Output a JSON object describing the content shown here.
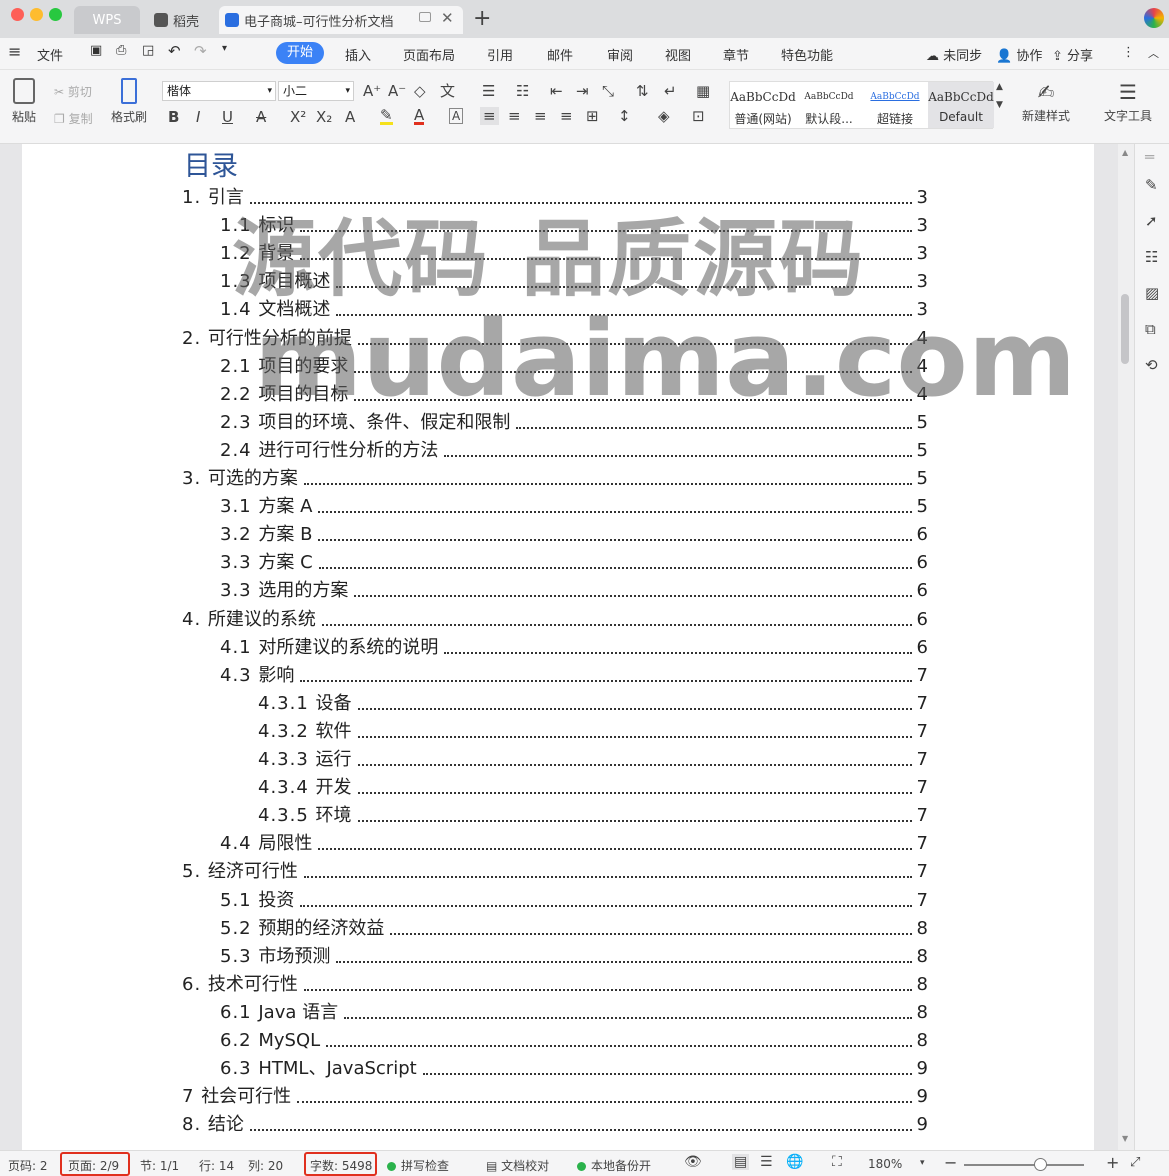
{
  "titlebar": {
    "tabs": [
      {
        "label": "WPS"
      },
      {
        "label": "稻壳"
      },
      {
        "label": "电子商城–可行性分析文档"
      }
    ],
    "new_tab_symbol": "+"
  },
  "menubar": {
    "file_label": "文件",
    "items": [
      "开始",
      "插入",
      "页面布局",
      "引用",
      "邮件",
      "审阅",
      "视图",
      "章节",
      "特色功能"
    ],
    "right": {
      "sync": "未同步",
      "collab": "协作",
      "share": "分享"
    }
  },
  "toolbar": {
    "paste": "粘贴",
    "cut": "剪切",
    "copy": "复制",
    "format_painter": "格式刷",
    "font_name": "楷体",
    "font_size": "小二",
    "styles": [
      {
        "sample": "AaBbCcDd",
        "name": "普通(网站)"
      },
      {
        "sample": "AaBbCcDd",
        "name": "默认段..."
      },
      {
        "sample": "AaBbCcDd",
        "name": "超链接"
      },
      {
        "sample": "AaBbCcDd",
        "name": "Default"
      }
    ],
    "new_style": "新建样式",
    "text_tool": "文字工具"
  },
  "document": {
    "toc_title": "目录",
    "entries": [
      {
        "num": "1. ",
        "text": "引言",
        "page": "3",
        "level": 1
      },
      {
        "num": "1.1 ",
        "text": "标识",
        "page": "3",
        "level": 2
      },
      {
        "num": "1.2 ",
        "text": "背景",
        "page": "3",
        "level": 2
      },
      {
        "num": "1.3 ",
        "text": "项目概述",
        "page": "3",
        "level": 2
      },
      {
        "num": "1.4 ",
        "text": "文档概述",
        "page": "3",
        "level": 2
      },
      {
        "num": "2. ",
        "text": "可行性分析的前提",
        "page": "4",
        "level": 1
      },
      {
        "num": "2.1 ",
        "text": "项目的要求",
        "page": "4",
        "level": 2
      },
      {
        "num": "2.2 ",
        "text": "项目的目标",
        "page": "4",
        "level": 2
      },
      {
        "num": "2.3 ",
        "text": "项目的环境、条件、假定和限制",
        "page": "5",
        "level": 2
      },
      {
        "num": "2.4 ",
        "text": "进行可行性分析的方法",
        "page": "5",
        "level": 2
      },
      {
        "num": "3. ",
        "text": "可选的方案",
        "page": "5",
        "level": 1
      },
      {
        "num": "3.1 ",
        "text": "方案 A",
        "page": "5",
        "level": 2
      },
      {
        "num": "3.2 ",
        "text": "方案 B",
        "page": "6",
        "level": 2
      },
      {
        "num": "3.3 ",
        "text": "方案 C",
        "page": "6",
        "level": 2
      },
      {
        "num": "3.3 ",
        "text": "选用的方案",
        "page": "6",
        "level": 2
      },
      {
        "num": "4. ",
        "text": "所建议的系统",
        "page": "6",
        "level": 1
      },
      {
        "num": "4.1 ",
        "text": "对所建议的系统的说明",
        "page": "6",
        "level": 2
      },
      {
        "num": "4.3 ",
        "text": "影响",
        "page": "7",
        "level": 2
      },
      {
        "num": "4.3.1 ",
        "text": "设备",
        "page": "7",
        "level": 3
      },
      {
        "num": "4.3.2 ",
        "text": "软件",
        "page": "7",
        "level": 3
      },
      {
        "num": "4.3.3 ",
        "text": "运行",
        "page": "7",
        "level": 3
      },
      {
        "num": "4.3.4 ",
        "text": "开发",
        "page": "7",
        "level": 3
      },
      {
        "num": "4.3.5 ",
        "text": "环境",
        "page": "7",
        "level": 3
      },
      {
        "num": "4.4 ",
        "text": "局限性",
        "page": "7",
        "level": 2
      },
      {
        "num": "5. ",
        "text": "经济可行性",
        "page": "7",
        "level": 1
      },
      {
        "num": "5.1 ",
        "text": "投资",
        "page": "7",
        "level": 2
      },
      {
        "num": "5.2 ",
        "text": "预期的经济效益",
        "page": "8",
        "level": 2
      },
      {
        "num": "5.3 ",
        "text": "市场预测",
        "page": "8",
        "level": 2
      },
      {
        "num": "6. ",
        "text": "技术可行性",
        "page": "8",
        "level": 1
      },
      {
        "num": "6.1 ",
        "text": "Java 语言",
        "page": "8",
        "level": 2
      },
      {
        "num": "6.2 ",
        "text": "MySQL",
        "page": "8",
        "level": 2
      },
      {
        "num": "6.3 ",
        "text": "HTML、JavaScript",
        "page": "9",
        "level": 2
      },
      {
        "num": "7 ",
        "text": "社会可行性",
        "page": "9",
        "level": 1
      },
      {
        "num": "8. ",
        "text": "结论",
        "page": "9",
        "level": 1
      }
    ],
    "watermark_line1": "源代码 品质源码",
    "watermark_line2": "mudaima.com"
  },
  "statusbar": {
    "page_num": "页码: 2",
    "pages": "页面: 2/9",
    "section": "节: 1/1",
    "row": "行: 14",
    "col": "列: 20",
    "word_count": "字数: 5498",
    "spell_check": "拼写检查",
    "doc_check": "文档校对",
    "backup": "本地备份开",
    "zoom": "180%"
  },
  "colors": {
    "accent": "#3b82f6",
    "toc_title": "#2e5597",
    "highlight_box": "#e0301e"
  }
}
